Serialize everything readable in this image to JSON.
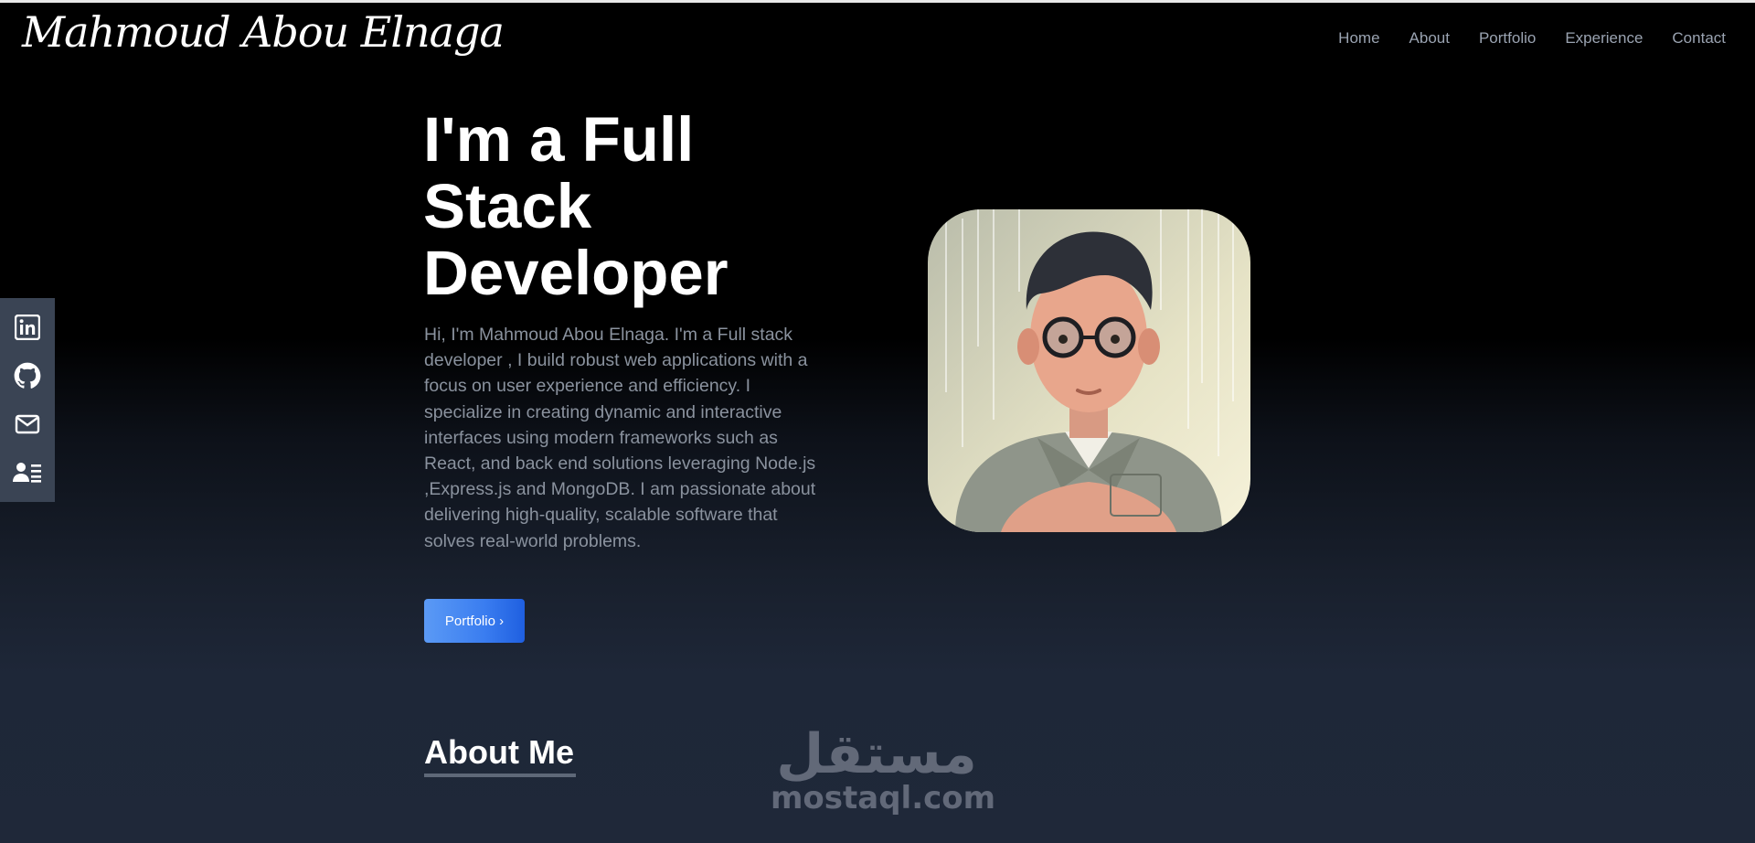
{
  "header": {
    "logo_text": "Mahmoud Abou Elnaga",
    "nav": [
      "Home",
      "About",
      "Portfolio",
      "Experience",
      "Contact"
    ]
  },
  "social": {
    "icons": [
      "linkedin-icon",
      "github-icon",
      "mail-icon",
      "resume-icon"
    ]
  },
  "hero": {
    "title_line1": "I'm a Full",
    "title_line2": "Stack",
    "title_line3": "Developer",
    "description": "Hi, I'm Mahmoud Abou Elnaga. I'm a Full stack developer , I build robust web applications with a focus on user experience and efficiency. I specialize in creating dynamic and interactive interfaces using modern frameworks such as React, and back end solutions leveraging Node.js ,Express.js and MongoDB. I am passionate about delivering high-quality, scalable software that solves real-world problems.",
    "cta_label": "Portfolio ›"
  },
  "about": {
    "title": "About Me"
  },
  "watermark": {
    "arabic": "مستقل",
    "latin": "mostaql.com"
  },
  "colors": {
    "accent": "#3a7df0",
    "nav_text": "#9aa3b1",
    "body_text": "#8a929e"
  }
}
